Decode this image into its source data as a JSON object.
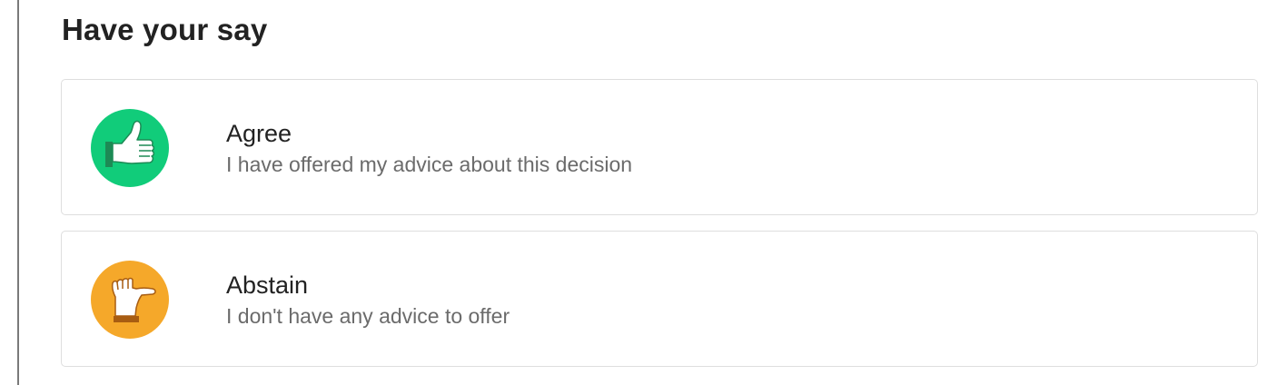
{
  "section": {
    "title": "Have your say"
  },
  "options": [
    {
      "label": "Agree",
      "description": "I have offered my advice about this decision",
      "icon": "thumbs-up-icon",
      "color": "#11cc7a"
    },
    {
      "label": "Abstain",
      "description": "I don't have any advice to offer",
      "icon": "thumb-sideways-icon",
      "color": "#f5a82a"
    }
  ]
}
